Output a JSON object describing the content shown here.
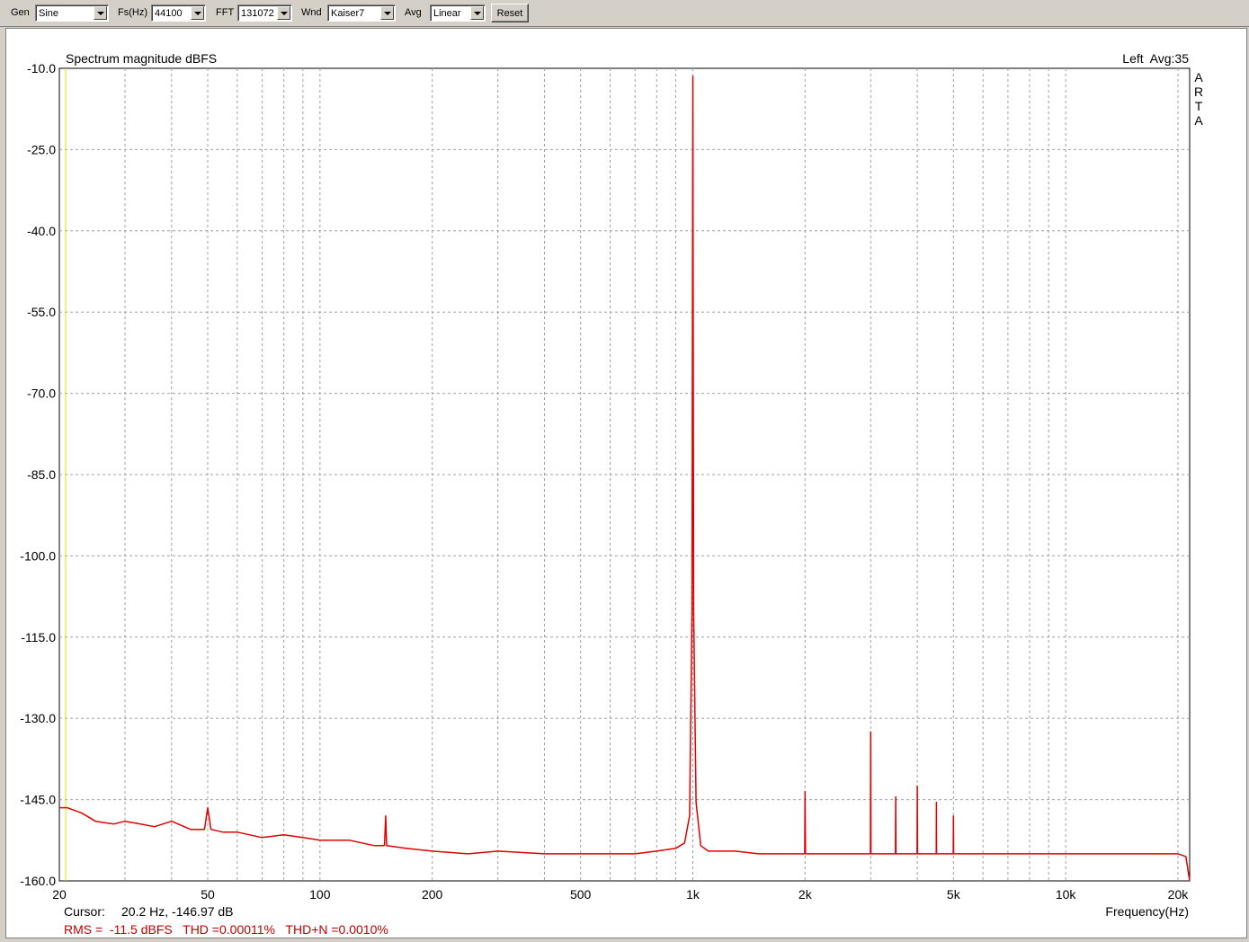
{
  "toolbar": {
    "gen_label": "Gen",
    "gen_value": "Sine",
    "fs_label": "Fs(Hz)",
    "fs_value": "44100",
    "fft_label": "FFT",
    "fft_value": "131072",
    "wnd_label": "Wnd",
    "wnd_value": "Kaiser7",
    "avg_label": "Avg",
    "avg_value": "Linear",
    "reset_label": "Reset"
  },
  "colors": {
    "trace": "#e00000",
    "grid": "#a0a0a0",
    "cursor": "#e0e000",
    "status_text": "#c00000"
  },
  "chart_data": {
    "type": "line",
    "title": "Spectrum magnitude dBFS",
    "channel_info": "Left  Avg:35",
    "brand_letters": [
      "A",
      "R",
      "T",
      "A"
    ],
    "xlabel": "Frequency(Hz)",
    "ylabel": "",
    "x_scale": "log",
    "xlim": [
      20,
      21500
    ],
    "ylim": [
      -160,
      -10
    ],
    "grid": true,
    "ytick_labels": [
      "-10.0",
      "-25.0",
      "-40.0",
      "-55.0",
      "-70.0",
      "-85.0",
      "-100.0",
      "-115.0",
      "-130.0",
      "-145.0",
      "-160.0"
    ],
    "ytick_values": [
      -10,
      -25,
      -40,
      -55,
      -70,
      -85,
      -100,
      -115,
      -130,
      -145,
      -160
    ],
    "xtick_labels": [
      "20",
      "50",
      "100",
      "200",
      "500",
      "1k",
      "2k",
      "5k",
      "10k",
      "20k"
    ],
    "xtick_values": [
      20,
      50,
      100,
      200,
      500,
      1000,
      2000,
      5000,
      10000,
      20000
    ],
    "series": [
      {
        "x": [
          20,
          21,
          23,
          25,
          28,
          30,
          33,
          36,
          40,
          45,
          49,
          50,
          51,
          55,
          60,
          70,
          80,
          90,
          100,
          120,
          140,
          149,
          150,
          151,
          170,
          200,
          250,
          300,
          400,
          500,
          600,
          700,
          800,
          900,
          950,
          980,
          995,
          1000,
          1005,
          1020,
          1050,
          1100,
          1300,
          1500,
          1800,
          1995,
          2000,
          2005,
          2500,
          2995,
          3000,
          3005,
          3495,
          3500,
          3505,
          3995,
          4000,
          4005,
          4495,
          4500,
          4505,
          4995,
          5000,
          5005,
          6000,
          7000,
          8000,
          9000,
          10000,
          12000,
          15000,
          18000,
          20000,
          21000,
          21500
        ],
        "y": [
          -146.5,
          -146.5,
          -147.5,
          -149.0,
          -149.5,
          -149.0,
          -149.5,
          -150.0,
          -149.0,
          -150.5,
          -150.5,
          -146.5,
          -150.5,
          -151.0,
          -151.0,
          -152.0,
          -151.5,
          -152.0,
          -152.5,
          -152.5,
          -153.5,
          -153.5,
          -148.0,
          -153.5,
          -154.0,
          -154.5,
          -155.0,
          -154.5,
          -155.0,
          -155.0,
          -155.0,
          -155.0,
          -154.5,
          -154.0,
          -153.0,
          -148.0,
          -110.0,
          -11.5,
          -110.0,
          -145.5,
          -153.5,
          -154.5,
          -154.5,
          -155.0,
          -155.0,
          -155.0,
          -143.5,
          -155.0,
          -155.0,
          -155.0,
          -132.5,
          -155.0,
          -155.0,
          -144.5,
          -155.0,
          -155.0,
          -142.5,
          -155.0,
          -155.0,
          -145.5,
          -155.0,
          -155.0,
          -148.0,
          -155.0,
          -155.0,
          -155.0,
          -155.0,
          -155.0,
          -155.0,
          -155.0,
          -155.0,
          -155.0,
          -155.0,
          -155.5,
          -160.0
        ]
      }
    ]
  },
  "status": {
    "cursor_label": "Cursor:",
    "cursor_value": "20.2 Hz, -146.97 dB",
    "measurements": "RMS =  -11.5 dBFS   THD =0.00011%   THD+N =0.0010%"
  }
}
